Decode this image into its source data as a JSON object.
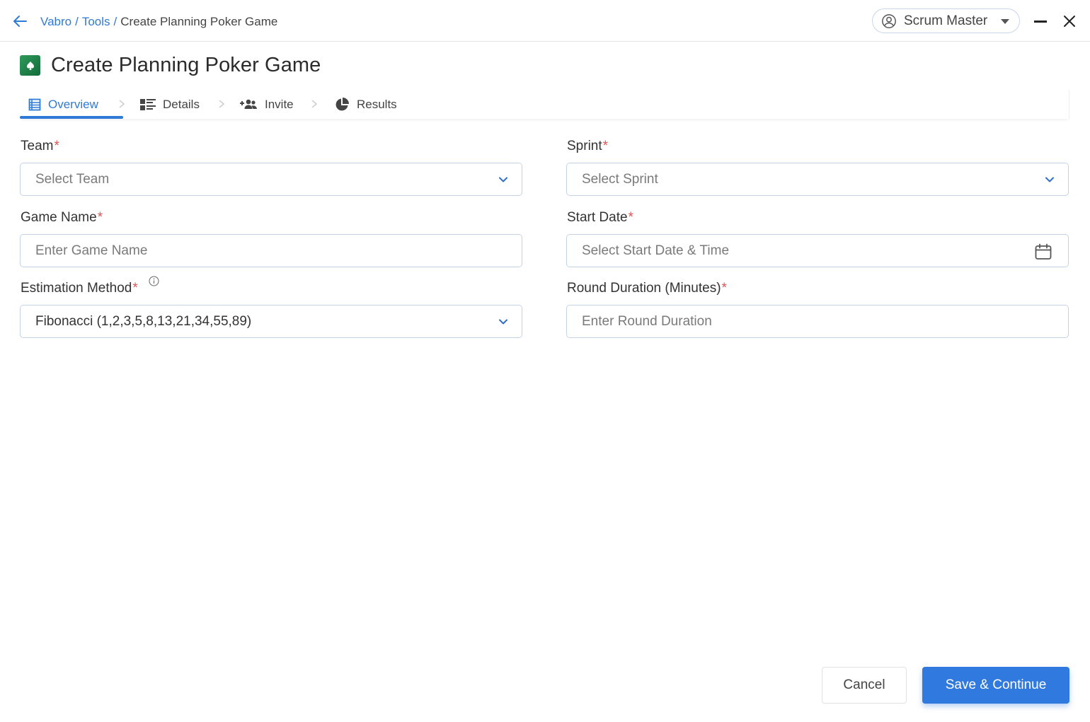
{
  "header": {
    "breadcrumb": [
      "Vabro",
      "Tools",
      "Create Planning Poker Game"
    ],
    "breadcrumb_sep": "/",
    "role": "Scrum Master"
  },
  "page": {
    "title": "Create Planning Poker Game",
    "logo_icon": "spade-icon"
  },
  "tabs": [
    {
      "label": "Overview",
      "icon": "list-icon",
      "active": true
    },
    {
      "label": "Details",
      "icon": "details-icon",
      "active": false
    },
    {
      "label": "Invite",
      "icon": "add-users-icon",
      "active": false
    },
    {
      "label": "Results",
      "icon": "pie-chart-icon",
      "active": false
    }
  ],
  "form": {
    "team": {
      "label": "Team",
      "required": "*",
      "placeholder": "Select Team"
    },
    "sprint": {
      "label": "Sprint",
      "required": "*",
      "placeholder": "Select Sprint"
    },
    "game_name": {
      "label": "Game Name",
      "required": "*",
      "placeholder": "Enter Game Name"
    },
    "start_date": {
      "label": "Start Date",
      "required": "*",
      "placeholder": "Select Start Date & Time"
    },
    "estimation_method": {
      "label": "Estimation Method",
      "required": "*",
      "value": "Fibonacci (1,2,3,5,8,13,21,34,55,89)"
    },
    "round_duration": {
      "label": "Round Duration (Minutes)",
      "required": "*",
      "placeholder": "Enter Round Duration"
    }
  },
  "actions": {
    "cancel": "Cancel",
    "save": "Save & Continue"
  },
  "colors": {
    "accent": "#2f7ad6",
    "primary_button": "#3079de",
    "required": "#e05454",
    "logo_green": "#1f8048"
  }
}
